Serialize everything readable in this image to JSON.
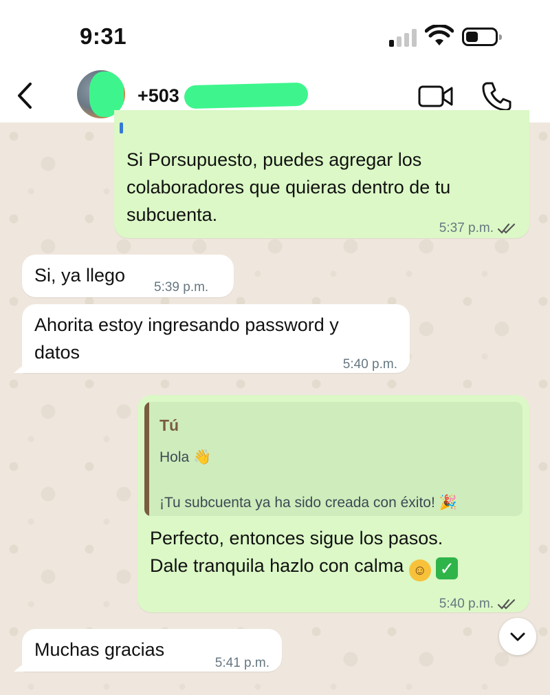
{
  "status_bar": {
    "time": "9:31",
    "signal_bars_on": 1,
    "signal_bars_total": 4,
    "battery_level": 0.35
  },
  "header": {
    "contact_name": "+503",
    "back_icon": "chevron-left-icon",
    "video_icon": "video-camera-icon",
    "call_icon": "phone-icon"
  },
  "messages": [
    {
      "direction": "out",
      "text": "Si Porsupuesto, puedes agregar los\ncolaboradores que quieras dentro de tu\nsubcuenta.",
      "time": "5:37 p.m.",
      "status": "read"
    },
    {
      "direction": "in",
      "text": "Si, ya llego",
      "time": "5:39 p.m."
    },
    {
      "direction": "in",
      "text": "Ahorita estoy ingresando password y\ndatos",
      "time": "5:40 p.m."
    },
    {
      "direction": "out",
      "quote": {
        "author": "Tú",
        "line1": "Hola",
        "line1_emoji": "👋",
        "line2": "¡Tu subcuenta ya ha sido creada con éxito!",
        "line2_emoji": "🎉"
      },
      "text_line1": "Perfecto, entonces sigue los pasos.",
      "text_line2": "Dale tranquila hazlo con calma",
      "emoji_1": "☺",
      "emoji_2": "✓",
      "time": "5:40 p.m.",
      "status": "read"
    },
    {
      "direction": "in",
      "text": "Muchas gracias",
      "time": "5:41 p.m."
    }
  ],
  "colors": {
    "outgoing_bubble": "#dbf8c6",
    "incoming_bubble": "#ffffff",
    "wallpaper": "#efe7dd",
    "quote_accent": "#7a5c3f",
    "read_ticks": "#667781"
  }
}
